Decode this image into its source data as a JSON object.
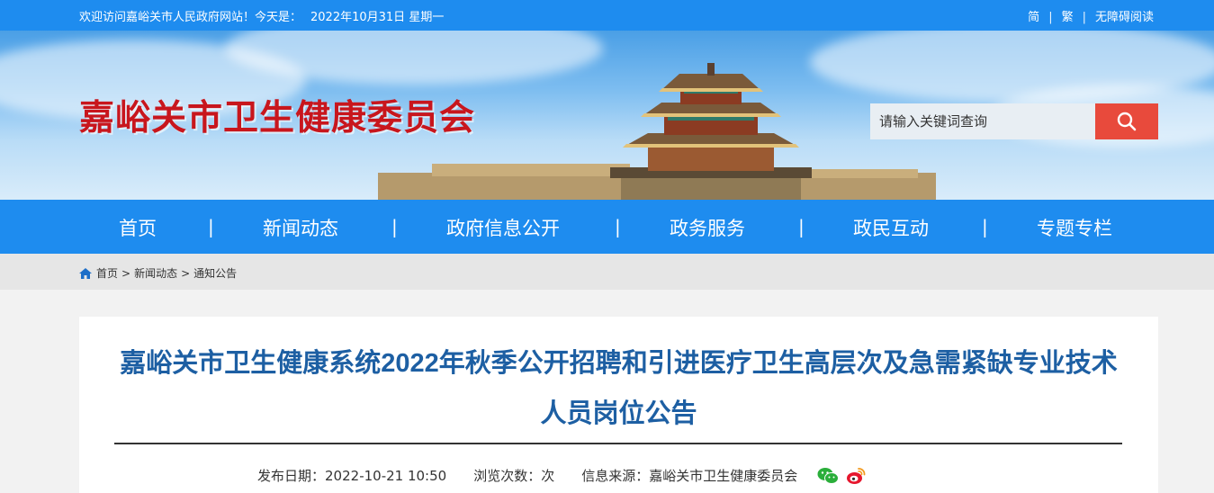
{
  "topbar": {
    "welcome": "欢迎访问嘉峪关市人民政府网站！今天是：",
    "date": "2022年10月31日 星期一",
    "links": [
      "简",
      "繁",
      "无障碍阅读"
    ],
    "sep": "|"
  },
  "banner": {
    "site_title": "嘉峪关市卫生健康委员会",
    "search_placeholder": "请输入关键词查询"
  },
  "nav": {
    "items": [
      "首页",
      "新闻动态",
      "政府信息公开",
      "政务服务",
      "政民互动",
      "专题专栏"
    ],
    "sep": "|"
  },
  "breadcrumb": {
    "items": [
      "首页",
      "新闻动态",
      "通知公告"
    ],
    "sep": ">"
  },
  "article": {
    "title": "嘉峪关市卫生健康系统2022年秋季公开招聘和引进医疗卫生高层次及急需紧缺专业技术人员岗位公告",
    "meta": {
      "publish_label": "发布日期：",
      "publish_value": "2022-10-21 10:50",
      "views_label": "浏览次数：",
      "views_unit": "次",
      "source_label": "信息来源：",
      "source_value": "嘉峪关市卫生健康委员会"
    }
  },
  "colors": {
    "brand_blue": "#1e8cef",
    "title_red": "#c8161d",
    "search_red": "#e84a3c",
    "article_title": "#1d5fa3"
  },
  "icons": [
    "search-icon",
    "home-icon",
    "wechat-icon",
    "weibo-icon"
  ]
}
